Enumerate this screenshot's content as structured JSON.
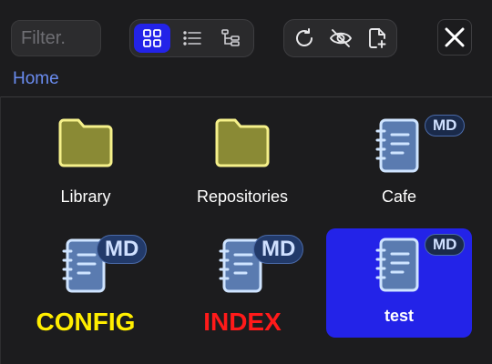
{
  "search": {
    "placeholder": "Filter."
  },
  "breadcrumb": {
    "home": "Home"
  },
  "items": [
    {
      "name": "Library",
      "type": "folder"
    },
    {
      "name": "Repositories",
      "type": "folder"
    },
    {
      "name": "Cafe",
      "type": "markdown",
      "badge": "MD"
    },
    {
      "name": "CONFIG",
      "type": "markdown",
      "badge": "MD",
      "label_color": "#ffee00"
    },
    {
      "name": "INDEX",
      "type": "markdown",
      "badge": "MD",
      "label_color": "#ff1a1a"
    },
    {
      "name": "test",
      "type": "markdown",
      "badge": "MD",
      "selected": true
    }
  ],
  "colors": {
    "accent": "#2323e8",
    "link": "#6a8cf0",
    "folder": "#8a8a35",
    "folder_border": "#f5f08a"
  },
  "icons": {
    "grid": "grid-view-icon",
    "list": "list-view-icon",
    "tree": "tree-view-icon",
    "refresh": "refresh-icon",
    "hidden": "eye-off-icon",
    "new_file": "new-file-icon",
    "close": "close-icon"
  }
}
